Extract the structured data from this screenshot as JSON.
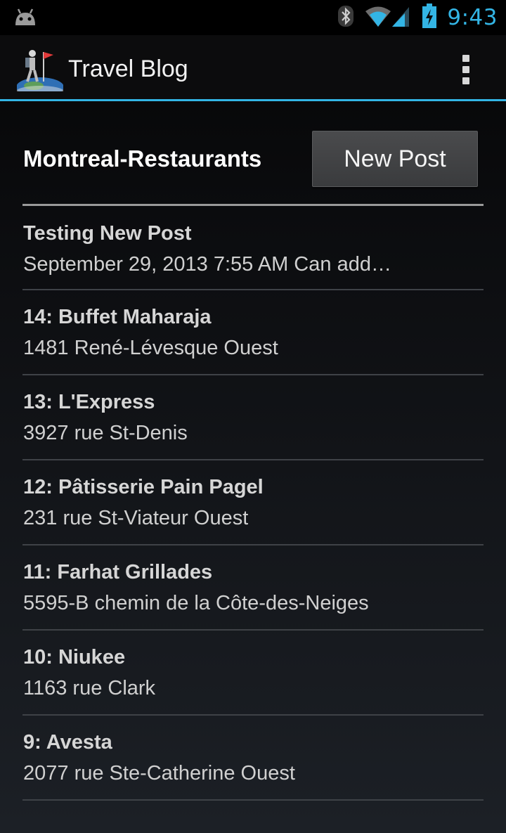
{
  "status_bar": {
    "time": "9:43",
    "icons": [
      "android-icon",
      "bluetooth-icon",
      "wifi-icon",
      "signal-icon",
      "battery-charging-icon"
    ],
    "accent_color": "#33b5e5"
  },
  "action_bar": {
    "title": "Travel Blog",
    "icon": "traveler-globe-icon",
    "overflow_icon": "overflow-menu-icon"
  },
  "blog": {
    "title": "Montreal-Restaurants",
    "new_post_label": "New Post"
  },
  "posts": [
    {
      "title": "Testing New Post",
      "subtitle": "September 29, 2013 7:55 AM Can add…"
    },
    {
      "title": "14: Buffet Maharaja",
      "subtitle": "1481 René-Lévesque Ouest"
    },
    {
      "title": "13: L'Express",
      "subtitle": "3927 rue St-Denis"
    },
    {
      "title": "12: Pâtisserie Pain Pagel",
      "subtitle": "231 rue St-Viateur Ouest"
    },
    {
      "title": "11: Farhat Grillades",
      "subtitle": "5595-B chemin de la Côte-des-Neiges"
    },
    {
      "title": "10: Niukee",
      "subtitle": "1163 rue Clark"
    },
    {
      "title": "9: Avesta",
      "subtitle": "2077 rue Ste-Catherine Ouest"
    }
  ]
}
